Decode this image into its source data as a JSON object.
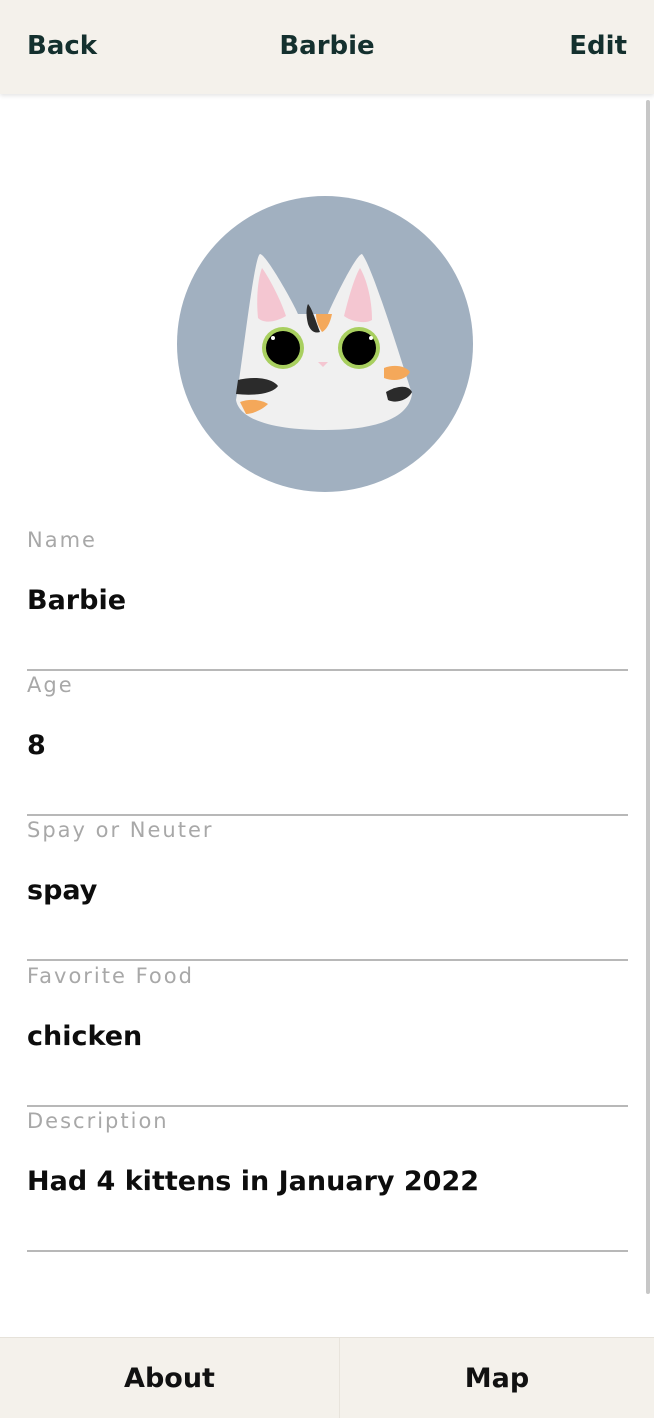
{
  "header": {
    "back_label": "Back",
    "title": "Barbie",
    "edit_label": "Edit"
  },
  "avatar": {
    "icon": "cat-face-icon",
    "background_color": "#a1b0c0"
  },
  "fields": [
    {
      "label": "Name",
      "value": "Barbie"
    },
    {
      "label": "Age",
      "value": "8"
    },
    {
      "label": "Spay or Neuter",
      "value": "spay"
    },
    {
      "label": "Favorite Food",
      "value": "chicken"
    },
    {
      "label": "Description",
      "value": "Had 4 kittens in January 2022"
    }
  ],
  "tabs": {
    "about_label": "About",
    "map_label": "Map"
  },
  "colors": {
    "header_bg": "#f4f1eb",
    "header_text": "#14302e",
    "label_text": "#a8a8a8"
  }
}
